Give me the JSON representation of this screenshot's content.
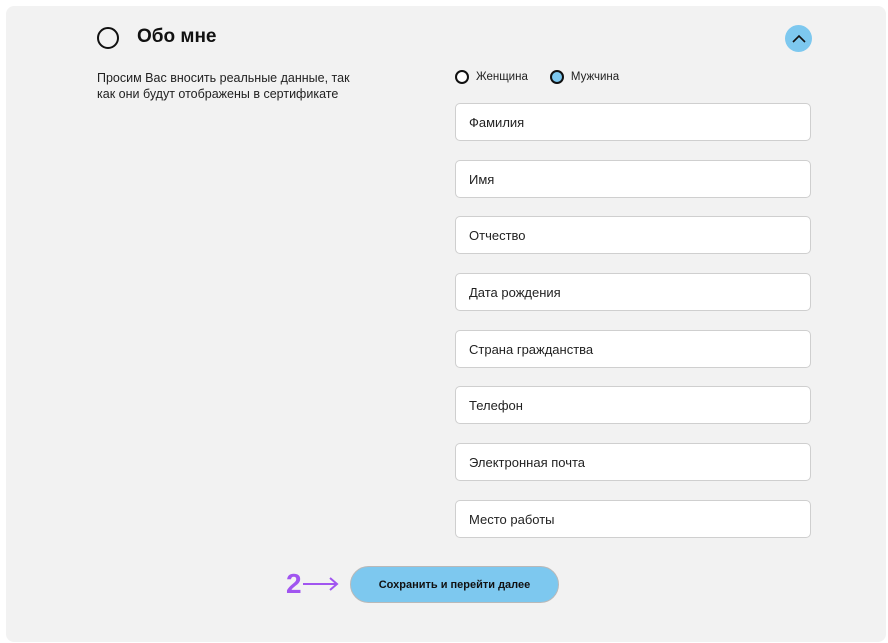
{
  "section": {
    "title": "Обо мне",
    "note": "Просим Вас вносить реальные данные, так как они будут отображены в сертификате"
  },
  "gender": {
    "options": [
      "Женщина",
      "Мужчина"
    ],
    "selected": "Мужчина"
  },
  "form": {
    "fields": [
      {
        "placeholder": "Фамилия"
      },
      {
        "placeholder": "Имя"
      },
      {
        "placeholder": "Отчество"
      },
      {
        "placeholder": "Дата рождения"
      },
      {
        "placeholder": "Страна гражданства"
      },
      {
        "placeholder": "Телефон"
      },
      {
        "placeholder": "Электронная почта"
      },
      {
        "placeholder": "Место работы"
      }
    ],
    "submit_label": "Сохранить и перейти далее"
  },
  "annotation": {
    "step": "2"
  },
  "colors": {
    "accent": "#7dc8ef",
    "panel_bg": "#f2f2f2",
    "annotation": "#a155f0"
  },
  "icons": {
    "collapse": "chevron-up-icon",
    "section_status": "circle-outline-icon",
    "annotation_arrow": "arrow-right-icon"
  }
}
